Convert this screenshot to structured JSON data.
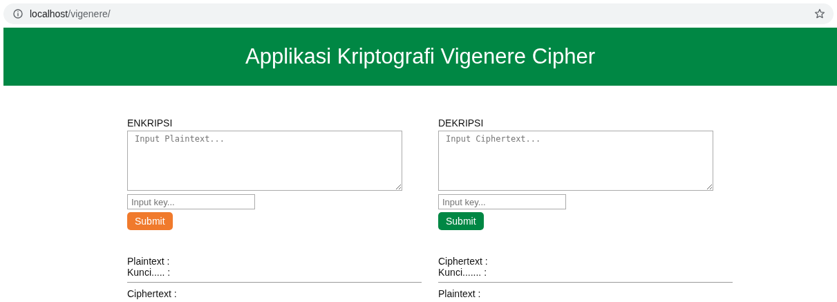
{
  "address_bar": {
    "host": "localhost",
    "path": "/vigenere/"
  },
  "header": {
    "title": "Applikasi Kriptografi Vigenere Cipher"
  },
  "panels": [
    {
      "title": "ENKRIPSI",
      "text_placeholder": "Input Plaintext...",
      "key_placeholder": "Input key...",
      "button": "Submit",
      "color": "#f07a2c",
      "results": [
        "Plaintext :",
        "Kunci..... :"
      ],
      "output": "Ciphertext :"
    },
    {
      "title": "DEKRIPSI",
      "text_placeholder": "Input Ciphertext...",
      "key_placeholder": "Input key...",
      "button": "Submit",
      "color": "#008744",
      "results": [
        "Ciphertext :",
        "Kunci....... :"
      ],
      "output": "Plaintext :"
    }
  ]
}
